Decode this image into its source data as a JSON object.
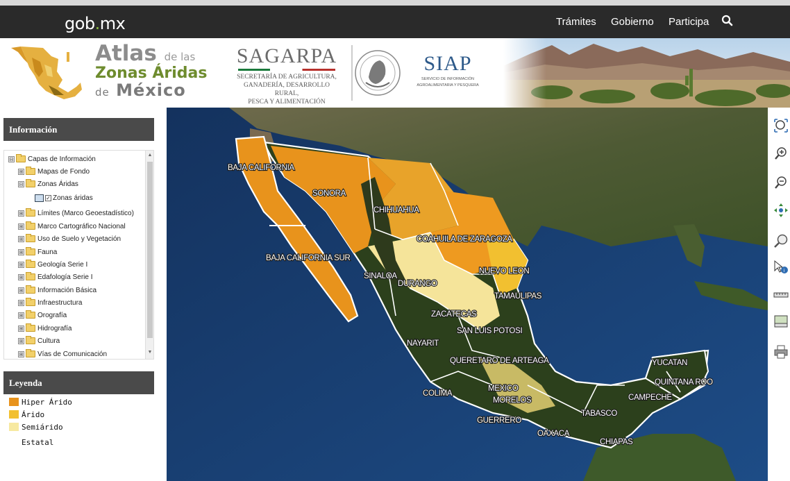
{
  "header": {
    "logo": {
      "left": "gob",
      "dot": ".",
      "right": "mx"
    },
    "nav": [
      "Trámites",
      "Gobierno",
      "Participa"
    ],
    "search_icon": "search-icon"
  },
  "banner": {
    "atlas": {
      "word1": "Atlas",
      "de_las": "de las",
      "line2": "Zonas Áridas",
      "de": "de",
      "mexico": "México"
    },
    "sagarpa": {
      "name": "SAGARPA",
      "desc1": "SECRETARÍA DE AGRICULTURA,",
      "desc2": "GANADERÍA, DESARROLLO RURAL,",
      "desc3": "PESCA Y ALIMENTACIÓN"
    },
    "siap": {
      "name": "SIAP",
      "desc1": "SERVICIO DE INFORMACIÓN",
      "desc2": "AGROALIMENTARIA Y PESQUERA"
    }
  },
  "info_panel": {
    "title": "Información",
    "tree": [
      {
        "label": "Capas de Información",
        "expander": "⊟"
      },
      {
        "label": "Mapas de Fondo",
        "expander": "⊞"
      },
      {
        "label": "Zonas Áridas",
        "expander": "⊟"
      },
      {
        "label": "Zonas áridas",
        "checked": "✓"
      },
      {
        "label": "Límites (Marco Geoestadístico)",
        "expander": "⊞"
      },
      {
        "label": "Marco Cartográfico Nacional",
        "expander": "⊞"
      },
      {
        "label": "Uso de Suelo y Vegetación",
        "expander": "⊞"
      },
      {
        "label": "Fauna",
        "expander": "⊞"
      },
      {
        "label": "Geología Serie I",
        "expander": "⊞"
      },
      {
        "label": "Edafología Serie I",
        "expander": "⊞"
      },
      {
        "label": "Información Básica",
        "expander": "⊞"
      },
      {
        "label": "Infraestructura",
        "expander": "⊞"
      },
      {
        "label": "Orografía",
        "expander": "⊞"
      },
      {
        "label": "Hidrografía",
        "expander": "⊞"
      },
      {
        "label": "Cultura",
        "expander": "⊞"
      },
      {
        "label": "Vías de Comunicación",
        "expander": "⊞"
      }
    ]
  },
  "legend_panel": {
    "title": "Leyenda",
    "items": [
      {
        "label": "Hiper Árido",
        "color": "#e8931c"
      },
      {
        "label": "Árido",
        "color": "#f2c030"
      },
      {
        "label": "Semiárido",
        "color": "#f7e9a0"
      },
      {
        "label": "Estatal",
        "color": "#ffffff"
      }
    ]
  },
  "map": {
    "states": [
      "BAJA CALIFORNIA",
      "SONORA",
      "CHIHUAHUA",
      "COAHUILA DE ZARAGOZA",
      "BAJA CALIFORNIA SUR",
      "SINALOA",
      "DURANGO",
      "NUEVO LEON",
      "TAMAULIPAS",
      "ZACATECAS",
      "SAN LUIS POTOSI",
      "NAYARIT",
      "QUERETARO DE ARTEAGA",
      "YUCATAN",
      "QUINTANA ROO",
      "MEXICO",
      "MORELOS",
      "CAMPECHE",
      "COLIMA",
      "TABASCO",
      "GUERRERO",
      "OAXACA",
      "CHIAPAS"
    ]
  },
  "tools": [
    "zoom-extent-icon",
    "zoom-in-icon",
    "zoom-out-icon",
    "pan-icon",
    "magnifier-icon",
    "identify-icon",
    "measure-icon",
    "measure-area-icon",
    "print-icon"
  ]
}
